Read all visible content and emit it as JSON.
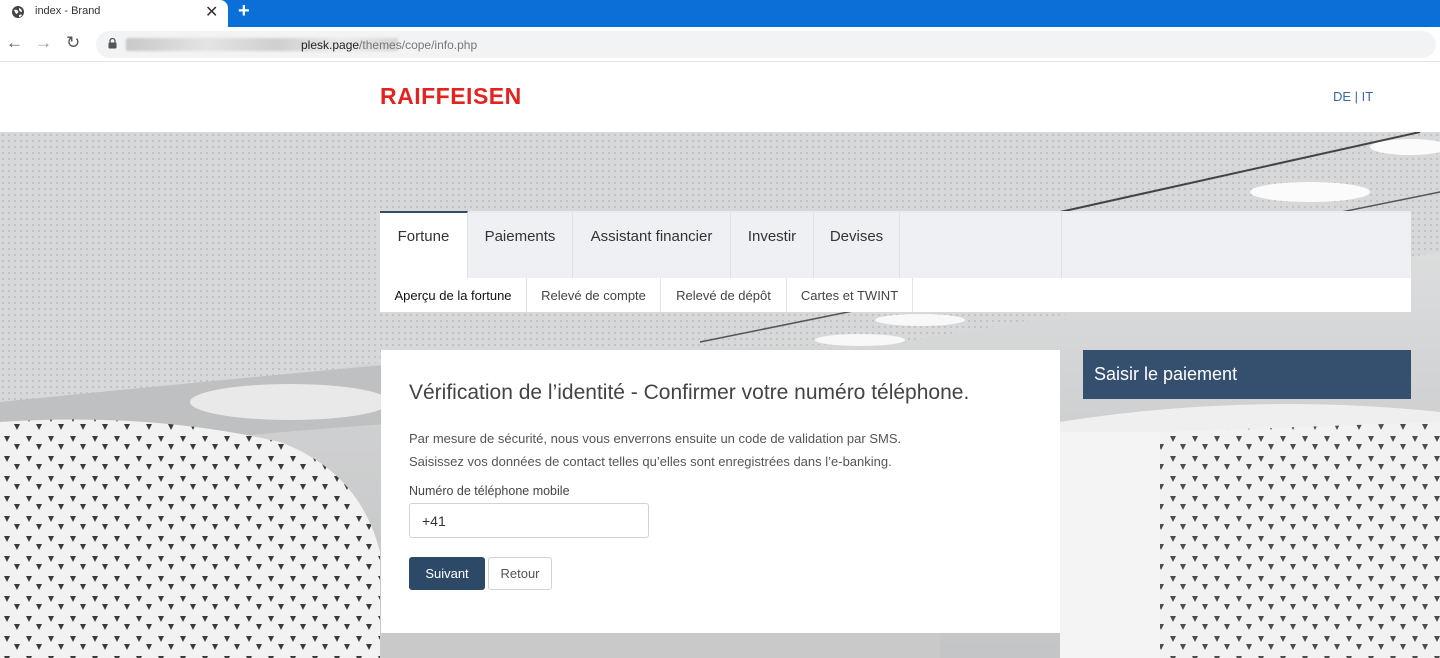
{
  "browser": {
    "tab_title": "index - Brand",
    "tab_close": "✕",
    "new_tab": "+",
    "url_host": "plesk.page",
    "url_path": "/themes/cope/info.php",
    "nav_back": "←",
    "nav_forward": "→",
    "nav_reload": "↻"
  },
  "header": {
    "logo": "RAIFFEISEN",
    "languages": "DE | IT"
  },
  "main_tabs": [
    "Fortune",
    "Paiements",
    "Assistant financier",
    "Investir",
    "Devises"
  ],
  "sub_tabs": [
    "Aperçu de la fortune",
    "Relevé de compte",
    "Relevé de dépôt",
    "Cartes et TWINT"
  ],
  "form": {
    "title": "Vérification de l’identité - Confirmer votre numéro téléphone.",
    "text_line1": "Par mesure de sécurité, nous vous enverrons ensuite un code de validation par SMS.",
    "text_line2": "Saisissez vos données de contact telles qu’elles sont enregistrées dans l’e-banking.",
    "phone_label": "Numéro de téléphone mobile",
    "phone_value": "+41",
    "next_button": "Suivant",
    "back_button": "Retour"
  },
  "sidebar": {
    "payment_button": "Saisir le paiement"
  },
  "colors": {
    "brand_red": "#e3231f",
    "primary_blue": "#2d4968",
    "side_box": "#34506e",
    "browser_blue": "#0b6fd8"
  }
}
